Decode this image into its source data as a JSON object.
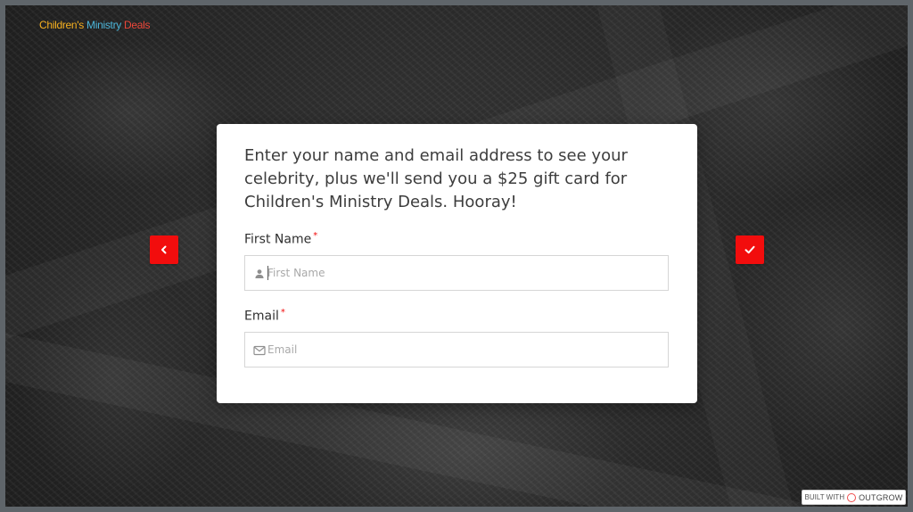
{
  "brand": {
    "logo_parts": [
      "Children's",
      " ",
      "Ministry",
      " ",
      "Deals"
    ],
    "colors": {
      "accent_red": "#f20d0d",
      "logo_yellow": "#f6b01f",
      "logo_red": "#ef4b2f",
      "logo_blue": "#4bb5d9"
    }
  },
  "navigation": {
    "prev_icon": "chevron-left-icon",
    "next_icon": "checkmark-icon"
  },
  "form": {
    "title": "Enter your name and email address to see your celebrity, plus we'll send you a $25 gift card for Children's Ministry Deals. Hooray!",
    "required_marker": "*",
    "fields": [
      {
        "label": "First Name",
        "placeholder": "First Name",
        "value": "",
        "icon": "user-icon"
      },
      {
        "label": "Email",
        "placeholder": "Email",
        "value": "",
        "icon": "mail-icon"
      }
    ]
  },
  "footer": {
    "built_with": "BUILT WITH",
    "brand": "OUTGROW"
  }
}
